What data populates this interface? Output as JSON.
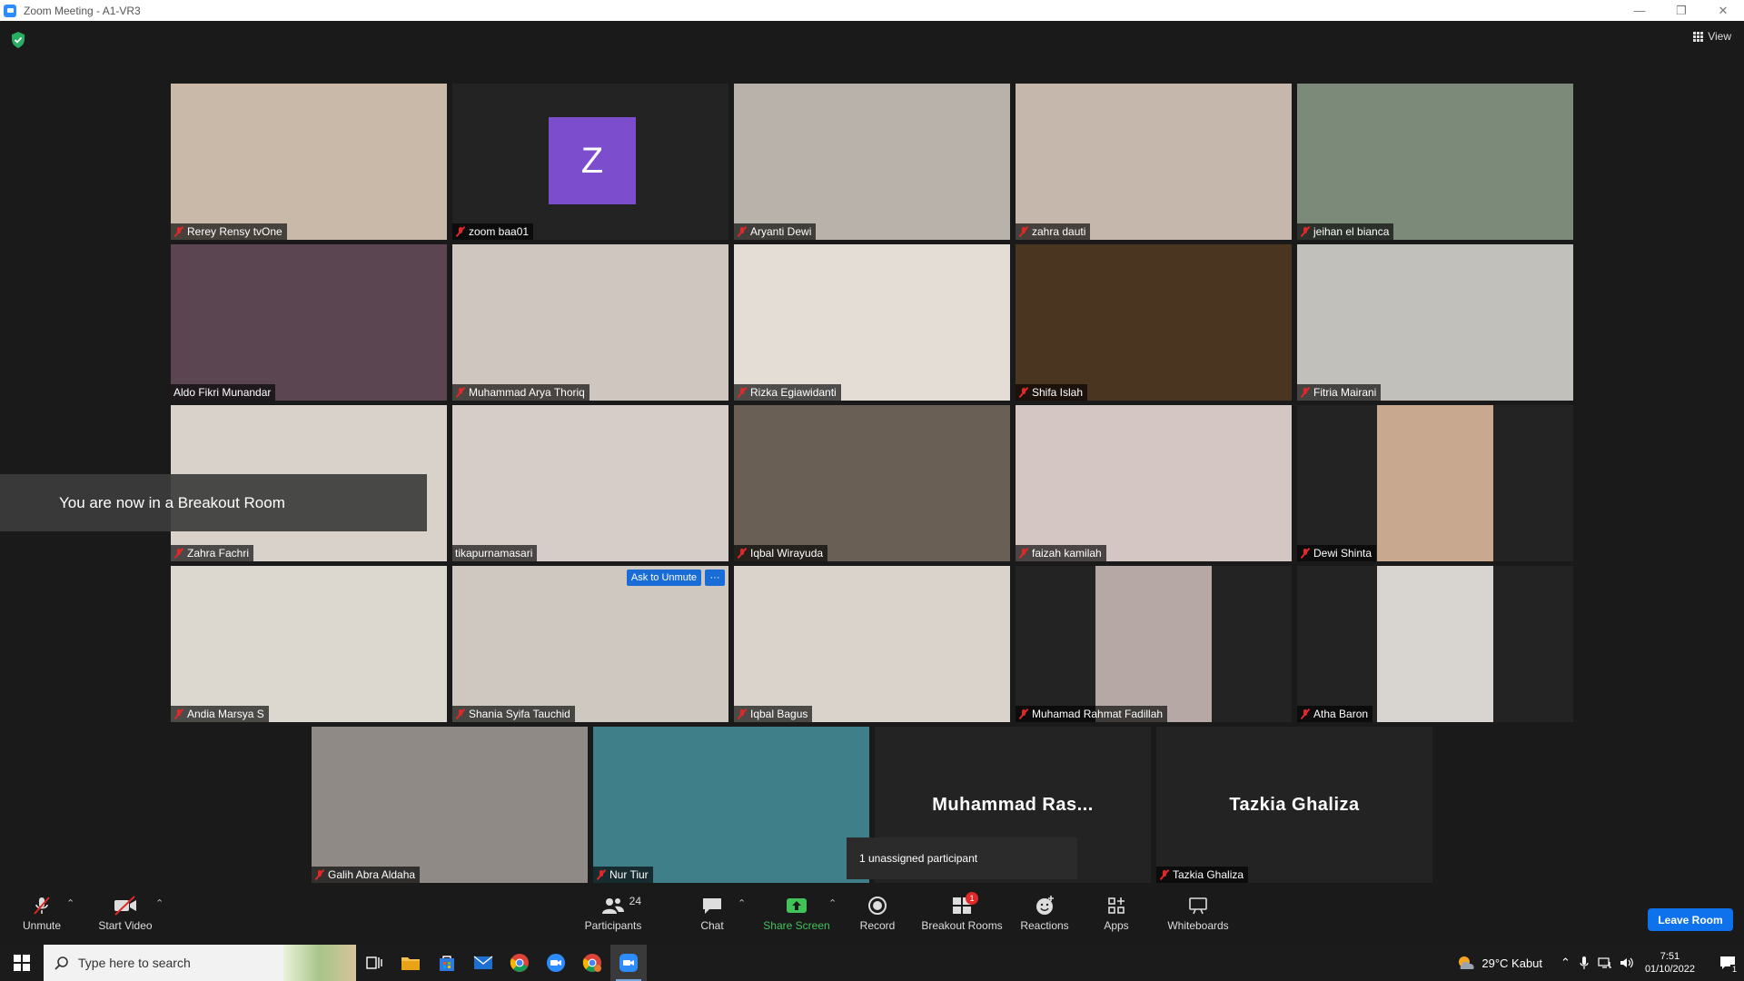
{
  "window": {
    "title": "Zoom Meeting - A1-VR3"
  },
  "header": {
    "view_label": "View"
  },
  "tiles": [
    {
      "name": "Rerey Rensy tvOne",
      "muted": true,
      "bg": "#c9b9a8"
    },
    {
      "name": "zoom baa01",
      "muted": true,
      "bg": "#232323",
      "avatar": "Z",
      "avatar_color": "#7c4dcc"
    },
    {
      "name": "Aryanti Dewi",
      "muted": true,
      "bg": "#b8b2aa"
    },
    {
      "name": "zahra dauti",
      "muted": true,
      "bg": "#c6b7ad"
    },
    {
      "name": "jeihan el bianca",
      "muted": true,
      "bg": "#7c8a7a"
    },
    {
      "name": "Aldo Fikri Munandar",
      "muted": false,
      "bg": "#5a4550",
      "speaking": true
    },
    {
      "name": "Muhammad Arya Thoriq",
      "muted": true,
      "bg": "#cfc6c0"
    },
    {
      "name": "Rizka Egiawidanti",
      "muted": true,
      "bg": "#e3ddd6"
    },
    {
      "name": "Shifa Islah",
      "muted": true,
      "bg": "#4a3520"
    },
    {
      "name": "Fitria Mairani",
      "muted": true,
      "bg": "#c2c0ba"
    },
    {
      "name": "Zahra Fachri",
      "muted": true,
      "bg": "#d8d2cb"
    },
    {
      "name": "tikapurnamasari",
      "muted": false,
      "bg": "#d6ccc8"
    },
    {
      "name": "Iqbal Wirayuda",
      "muted": true,
      "bg": "#6a5f55"
    },
    {
      "name": "faizah kamilah",
      "muted": true,
      "bg": "#d4c6c3"
    },
    {
      "name": "Dewi Shinta",
      "muted": true,
      "bg": "#232323",
      "inset_bg": "#c9a890"
    },
    {
      "name": "Andia Marsya S",
      "muted": true,
      "bg": "#ddd8cf"
    },
    {
      "name": "Shania Syifa Tauchid",
      "muted": true,
      "bg": "#cfc8c0",
      "ask_unmute": "Ask to Unmute",
      "more": "···"
    },
    {
      "name": "Iqbal Bagus",
      "muted": true,
      "bg": "#d9d3cb"
    },
    {
      "name": "Muhamad Rahmat Fadillah",
      "muted": true,
      "bg": "#232323",
      "inset_bg": "#b6a8a4"
    },
    {
      "name": "Atha Baron",
      "muted": true,
      "bg": "#232323",
      "inset_bg": "#d8d4d0"
    },
    {
      "name": "Galih Abra Aldaha",
      "muted": true,
      "bg": "#8f8a85"
    },
    {
      "name": "Nur Tiur",
      "muted": true,
      "bg": "#3f7f8a"
    },
    {
      "name": "",
      "center_name": "Muhammad  Ras...",
      "bg": "#232323"
    },
    {
      "name": "Tazkia Ghaliza",
      "muted": true,
      "center_name": "Tazkia Ghaliza",
      "bg": "#232323"
    }
  ],
  "notifications": {
    "breakout": "You are now in a Breakout Room",
    "unassigned": "1 unassigned participant"
  },
  "toolbar": {
    "unmute": "Unmute",
    "start_video": "Start Video",
    "participants": "Participants",
    "participants_count": "24",
    "chat": "Chat",
    "share_screen": "Share Screen",
    "record": "Record",
    "breakout_rooms": "Breakout Rooms",
    "breakout_badge": "1",
    "reactions": "Reactions",
    "apps": "Apps",
    "whiteboards": "Whiteboards",
    "leave": "Leave Room"
  },
  "taskbar": {
    "search_placeholder": "Type here to search",
    "weather": "29°C  Kabut",
    "time": "7:51",
    "date": "01/10/2022",
    "notif_count": "1"
  },
  "colors": {
    "accent": "#0e72ed",
    "muted": "#e02828",
    "speaking": "#d5f040",
    "share": "#41c35a"
  }
}
